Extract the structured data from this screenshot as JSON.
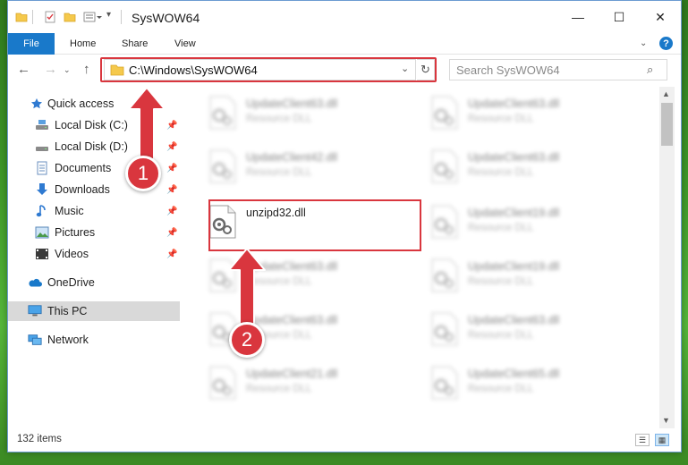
{
  "window": {
    "title": "SysWOW64",
    "controls": {
      "minimize": "—",
      "maximize": "☐",
      "close": "✕"
    }
  },
  "ribbon": {
    "tabs": [
      "File",
      "Home",
      "Share",
      "View"
    ],
    "help": "?"
  },
  "address": {
    "path": "C:\\Windows\\SysWOW64",
    "search_placeholder": "Search SysWOW64"
  },
  "nav": {
    "items": [
      {
        "label": "Quick access",
        "icon": "star-icon"
      },
      {
        "label": "Local Disk (C:)",
        "icon": "drive-icon",
        "pinned": true
      },
      {
        "label": "Local Disk (D:)",
        "icon": "drive-icon",
        "pinned": true
      },
      {
        "label": "Documents",
        "icon": "documents-icon",
        "pinned": true
      },
      {
        "label": "Downloads",
        "icon": "download-icon",
        "pinned": true
      },
      {
        "label": "Music",
        "icon": "music-icon",
        "pinned": true
      },
      {
        "label": "Pictures",
        "icon": "pictures-icon",
        "pinned": true
      },
      {
        "label": "Videos",
        "icon": "videos-icon",
        "pinned": true
      },
      {
        "label": "OneDrive",
        "icon": "cloud-icon"
      },
      {
        "label": "This PC",
        "icon": "computer-icon",
        "selected": true
      },
      {
        "label": "Network",
        "icon": "network-icon"
      }
    ]
  },
  "files": {
    "left": [
      {
        "name": "UpdateClient63.dll",
        "type": "Resource DLL"
      },
      {
        "name": "UpdateClient42.dll",
        "type": "Resource DLL"
      },
      {
        "name": "unzipd32.dll",
        "type": ""
      },
      {
        "name": "UpdateClient63.dll",
        "type": "Resource DLL"
      },
      {
        "name": "UpdateClient63.dll",
        "type": "Resource DLL"
      },
      {
        "name": "UpdateClient21.dll",
        "type": "Resource DLL"
      }
    ],
    "right": [
      {
        "name": "UpdateClient63.dll",
        "type": "Resource DLL"
      },
      {
        "name": "UpdateClient63.dll",
        "type": "Resource DLL"
      },
      {
        "name": "UpdateClient19.dll",
        "type": "Resource DLL"
      },
      {
        "name": "UpdateClient19.dll",
        "type": "Resource DLL"
      },
      {
        "name": "UpdateClient63.dll",
        "type": "Resource DLL"
      },
      {
        "name": "UpdateClient65.dll",
        "type": "Resource DLL"
      }
    ]
  },
  "status": {
    "item_count": "132 items"
  },
  "annotations": {
    "step1": "1",
    "step2": "2"
  },
  "colors": {
    "accent": "#1979ca",
    "highlight": "#d9363e"
  }
}
